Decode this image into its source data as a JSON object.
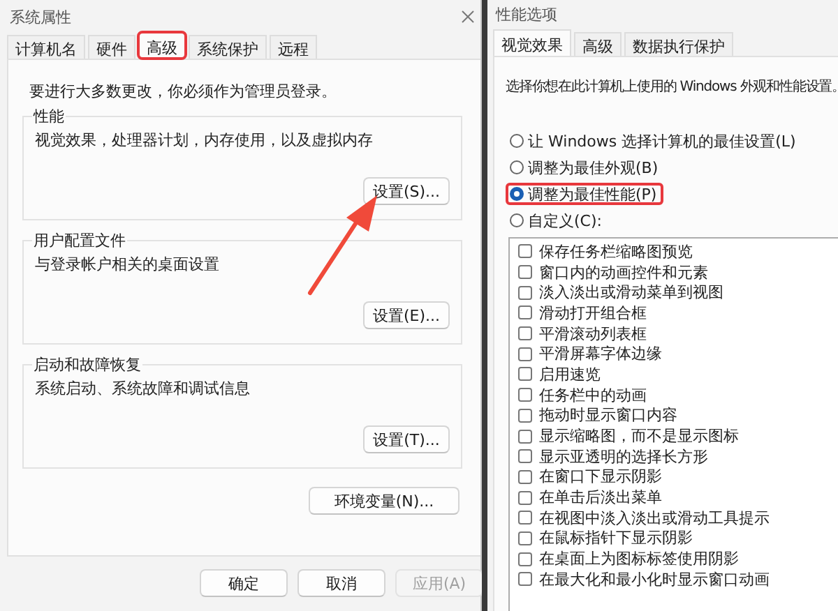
{
  "system_properties": {
    "title": "系统属性",
    "tabs": [
      {
        "label": "计算机名",
        "selected": false,
        "highlighted": false
      },
      {
        "label": "硬件",
        "selected": false,
        "highlighted": false
      },
      {
        "label": "高级",
        "selected": true,
        "highlighted": true
      },
      {
        "label": "系统保护",
        "selected": false,
        "highlighted": false
      },
      {
        "label": "远程",
        "selected": false,
        "highlighted": false
      }
    ],
    "admin_note": "要进行大多数更改，你必须作为管理员登录。",
    "groups": [
      {
        "title": "性能",
        "description": "视觉效果，处理器计划，内存使用，以及虚拟内存",
        "button": "设置(S)..."
      },
      {
        "title": "用户配置文件",
        "description": "与登录帐户相关的桌面设置",
        "button": "设置(E)..."
      },
      {
        "title": "启动和故障恢复",
        "description": "系统启动、系统故障和调试信息",
        "button": "设置(T)..."
      }
    ],
    "env_button": "环境变量(N)...",
    "buttons": [
      {
        "label": "确定",
        "disabled": false
      },
      {
        "label": "取消",
        "disabled": false
      },
      {
        "label": "应用(A)",
        "disabled": true
      }
    ]
  },
  "performance_options": {
    "title": "性能选项",
    "tabs": [
      {
        "label": "视觉效果",
        "selected": true
      },
      {
        "label": "高级",
        "selected": false
      },
      {
        "label": "数据执行保护",
        "selected": false
      }
    ],
    "intro": "选择你想在此计算机上使用的 Windows 外观和性能设置。",
    "options": [
      {
        "label": "让 Windows 选择计算机的最佳设置(L)",
        "selected": false,
        "highlighted": false
      },
      {
        "label": "调整为最佳外观(B)",
        "selected": false,
        "highlighted": false
      },
      {
        "label": "调整为最佳性能(P)",
        "selected": true,
        "highlighted": true
      },
      {
        "label": "自定义(C):",
        "selected": false,
        "highlighted": false
      }
    ],
    "effects": [
      {
        "label": "保存任务栏缩略图预览",
        "checked": false
      },
      {
        "label": "窗口内的动画控件和元素",
        "checked": false
      },
      {
        "label": "淡入淡出或滑动菜单到视图",
        "checked": false
      },
      {
        "label": "滑动打开组合框",
        "checked": false
      },
      {
        "label": "平滑滚动列表框",
        "checked": false
      },
      {
        "label": "平滑屏幕字体边缘",
        "checked": false
      },
      {
        "label": "启用速览",
        "checked": false
      },
      {
        "label": "任务栏中的动画",
        "checked": false
      },
      {
        "label": "拖动时显示窗口内容",
        "checked": false
      },
      {
        "label": "显示缩略图，而不是显示图标",
        "checked": false
      },
      {
        "label": "显示亚透明的选择长方形",
        "checked": false
      },
      {
        "label": "在窗口下显示阴影",
        "checked": false
      },
      {
        "label": "在单击后淡出菜单",
        "checked": false
      },
      {
        "label": "在视图中淡入淡出或滑动工具提示",
        "checked": false
      },
      {
        "label": "在鼠标指针下显示阴影",
        "checked": false
      },
      {
        "label": "在桌面上为图标标签使用阴影",
        "checked": false
      },
      {
        "label": "在最大化和最小化时显示窗口动画",
        "checked": false
      }
    ]
  }
}
